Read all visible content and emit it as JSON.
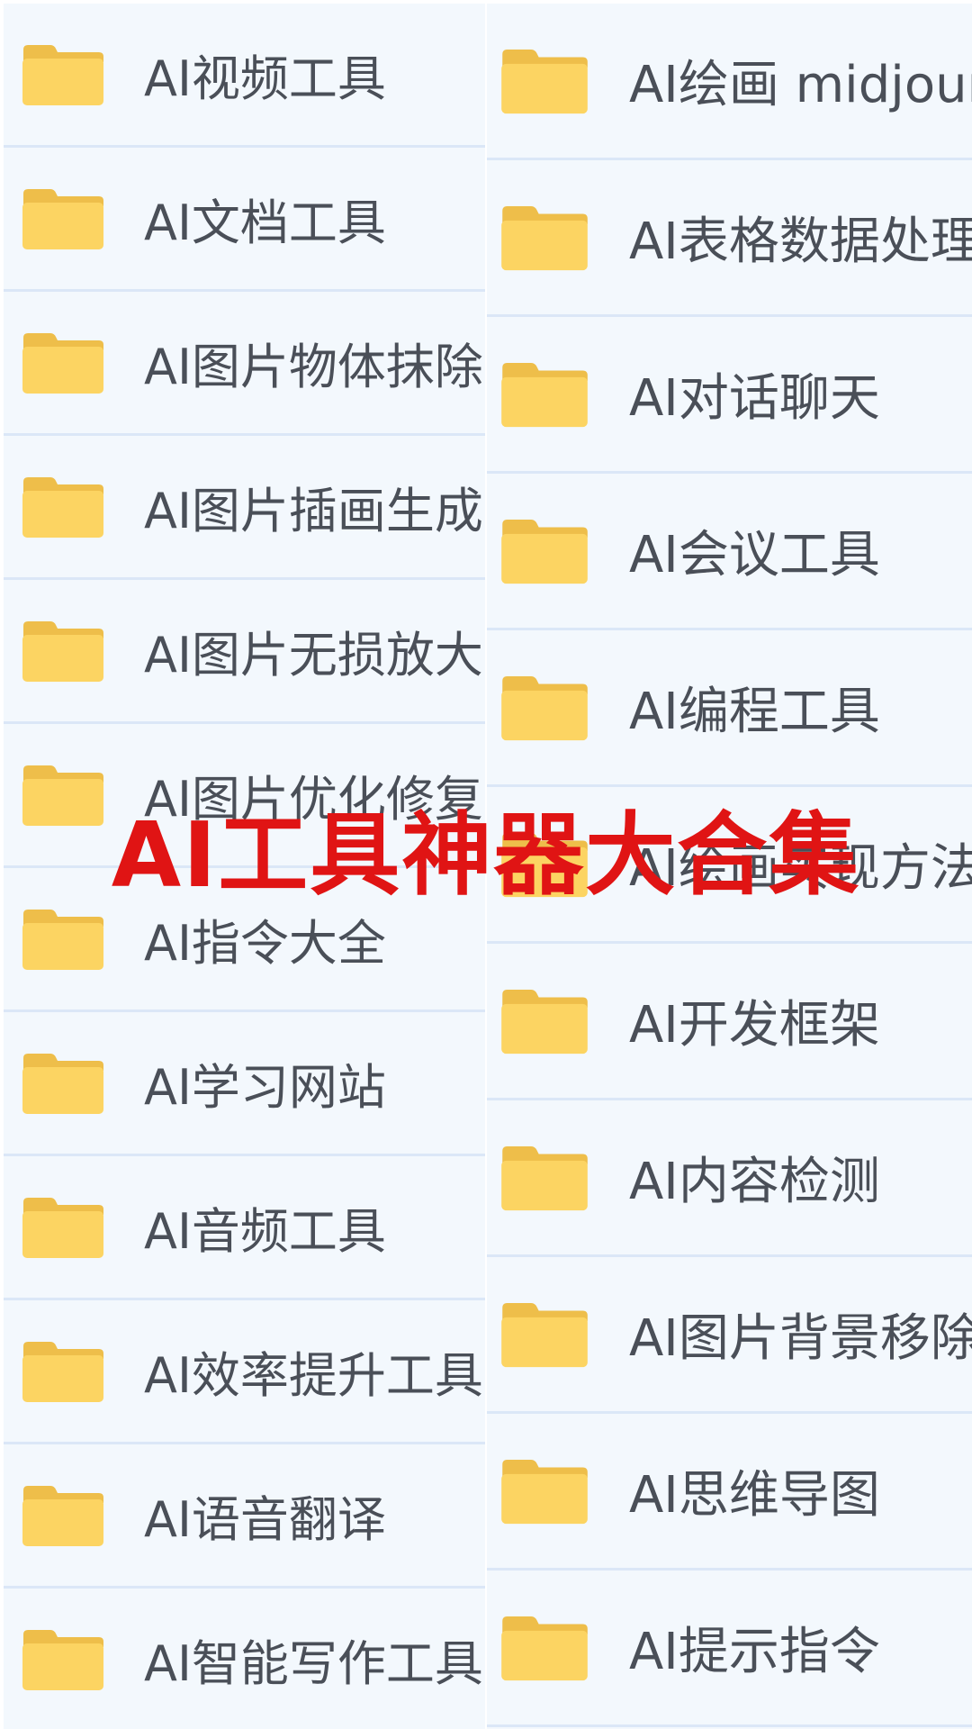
{
  "colors": {
    "background": "#f3f8fd",
    "divider": "#dbe7f7",
    "folder_front": "#fcd462",
    "folder_back": "#eebe4a",
    "label_text": "#4a4f58",
    "overlay_title": "#e01414"
  },
  "overlay": {
    "title": "AI工具神器大合集"
  },
  "left_folders": [
    {
      "icon": "folder-icon",
      "label": "AI视频工具"
    },
    {
      "icon": "folder-icon",
      "label": "AI文档工具"
    },
    {
      "icon": "folder-icon",
      "label": "AI图片物体抹除"
    },
    {
      "icon": "folder-icon",
      "label": "AI图片插画生成"
    },
    {
      "icon": "folder-icon",
      "label": "AI图片无损放大"
    },
    {
      "icon": "folder-icon",
      "label": "AI图片优化修复"
    },
    {
      "icon": "folder-icon",
      "label": "AI指令大全"
    },
    {
      "icon": "folder-icon",
      "label": "AI学习网站"
    },
    {
      "icon": "folder-icon",
      "label": "AI音频工具"
    },
    {
      "icon": "folder-icon",
      "label": "AI效率提升工具"
    },
    {
      "icon": "folder-icon",
      "label": "AI语音翻译"
    },
    {
      "icon": "folder-icon",
      "label": "AI智能写作工具"
    }
  ],
  "right_folders": [
    {
      "icon": "folder-icon",
      "label": "AI绘画 midjourney"
    },
    {
      "icon": "folder-icon",
      "label": "AI表格数据处理"
    },
    {
      "icon": "folder-icon",
      "label": "AI对话聊天"
    },
    {
      "icon": "folder-icon",
      "label": "AI会议工具"
    },
    {
      "icon": "folder-icon",
      "label": "AI编程工具"
    },
    {
      "icon": "folder-icon",
      "label": "AI绘画实现方法"
    },
    {
      "icon": "folder-icon",
      "label": "AI开发框架"
    },
    {
      "icon": "folder-icon",
      "label": "AI内容检测"
    },
    {
      "icon": "folder-icon",
      "label": "AI图片背景移除"
    },
    {
      "icon": "folder-icon",
      "label": "AI思维导图"
    },
    {
      "icon": "folder-icon",
      "label": "AI提示指令"
    }
  ]
}
